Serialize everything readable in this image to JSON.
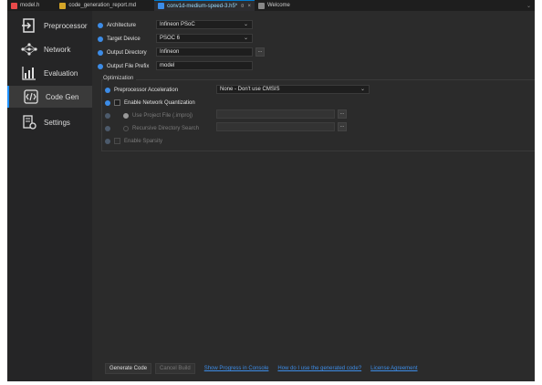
{
  "tabs": [
    {
      "label": "model.h",
      "icon": "c-header-file-icon",
      "color": "#e84a4a",
      "active": false
    },
    {
      "label": "code_generation_report.md",
      "icon": "markdown-file-icon",
      "color": "#d4a528",
      "active": false
    },
    {
      "label": "conv1d-medium-speed-3.h5*",
      "icon": "model-file-icon",
      "color": "#3c8ce7",
      "active": true,
      "pin": "¤",
      "close": "×"
    },
    {
      "label": "Welcome",
      "icon": "welcome-icon",
      "color": "#888888",
      "active": false
    }
  ],
  "tab_overflow": "⌄",
  "sidebar": [
    {
      "label": "Preprocessor",
      "icon": "preprocessor-icon"
    },
    {
      "label": "Network",
      "icon": "network-icon"
    },
    {
      "label": "Evaluation",
      "icon": "evaluation-icon"
    },
    {
      "label": "Code Gen",
      "icon": "code-gen-icon",
      "active": true
    },
    {
      "label": "Settings",
      "icon": "settings-icon"
    }
  ],
  "form": {
    "architecture": {
      "label": "Architecture",
      "value": "Infineon PSoC"
    },
    "target_device": {
      "label": "Target Device",
      "value": "PSOC 6"
    },
    "output_directory": {
      "label": "Output Directory",
      "value": "Infineon",
      "browse": "..."
    },
    "output_file_prefix": {
      "label": "Output File Prefix",
      "value": "model"
    }
  },
  "optimization": {
    "title": "Optimization",
    "preprocessor_acceleration": {
      "label": "Preprocessor Acceleration",
      "value": "None - Don't use CMSIS"
    },
    "enable_network_quantization": {
      "label": "Enable Network Quantization",
      "checked": false
    },
    "use_project_file": {
      "label": "Use Project File (.improj)",
      "value": "",
      "browse": "..."
    },
    "recursive_directory_search": {
      "label": "Recursive Directory Search",
      "value": "",
      "browse": "..."
    },
    "enable_sparsity": {
      "label": "Enable Sparsity",
      "checked": false
    }
  },
  "footer": {
    "generate_code": "Generate Code",
    "cancel_build": "Cancel Build",
    "link_progress": "Show Progress in Console",
    "link_how_to": "How do I use the generated code?",
    "link_license": "License Agreement"
  },
  "colors": {
    "accent": "#3c8ce7",
    "background": "#2b2b2b",
    "sidebar": "#252526",
    "tabbar": "#1e1e1e"
  }
}
